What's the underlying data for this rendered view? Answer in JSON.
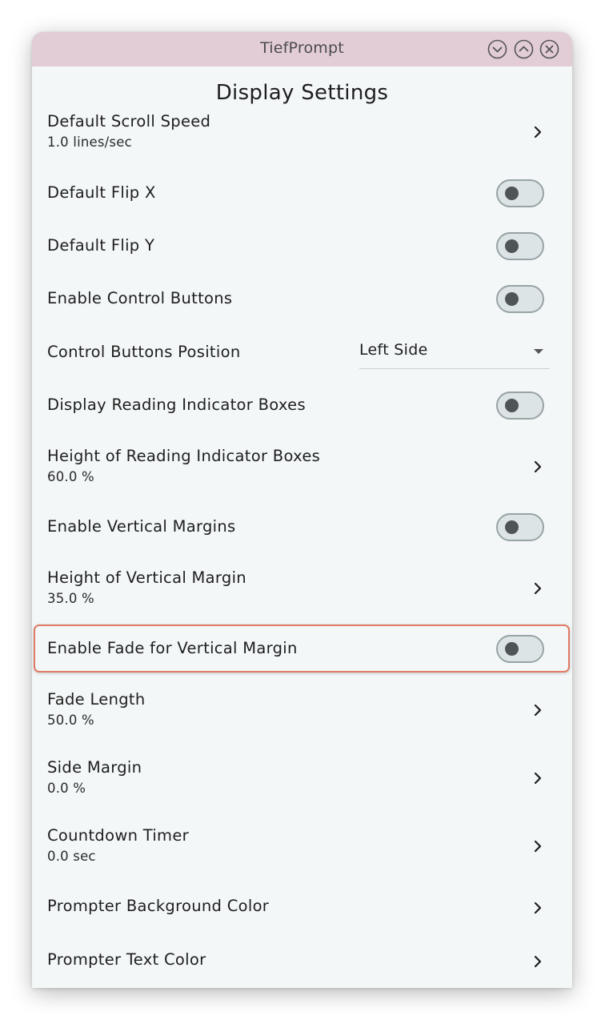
{
  "window": {
    "title": "TiefPrompt",
    "minimize_icon": "chevron-down-circle-icon",
    "maximize_icon": "chevron-up-circle-icon",
    "close_icon": "close-circle-icon",
    "titlebar_color": "#e2ccd6"
  },
  "page": {
    "title": "Display Settings"
  },
  "settings": [
    {
      "label": "Default Scroll Speed",
      "value": "1.0 lines/sec",
      "type": "link"
    },
    {
      "label": "Default Flip X",
      "type": "toggle",
      "on": false
    },
    {
      "label": "Default Flip Y",
      "type": "toggle",
      "on": false
    },
    {
      "label": "Enable Control Buttons",
      "type": "toggle",
      "on": false
    },
    {
      "label": "Control Buttons Position",
      "type": "dropdown",
      "selected": "Left Side"
    },
    {
      "label": "Display Reading Indicator Boxes",
      "type": "toggle",
      "on": false
    },
    {
      "label": "Height of Reading Indicator Boxes",
      "value": "60.0 %",
      "type": "link"
    },
    {
      "label": "Enable Vertical Margins",
      "type": "toggle",
      "on": false
    },
    {
      "label": "Height of Vertical Margin",
      "value": "35.0 %",
      "type": "link"
    },
    {
      "label": "Enable Fade for Vertical Margin",
      "type": "toggle",
      "on": false,
      "highlighted": true
    },
    {
      "label": "Fade Length",
      "value": "50.0 %",
      "type": "link"
    },
    {
      "label": "Side Margin",
      "value": "0.0 %",
      "type": "link"
    },
    {
      "label": "Countdown Timer",
      "value": "0.0 sec",
      "type": "link"
    },
    {
      "label": "Prompter Background Color",
      "type": "link"
    },
    {
      "label": "Prompter Text Color",
      "type": "link"
    }
  ],
  "colors": {
    "background": "#f3f7f8",
    "highlight_border": "#e07a64",
    "toggle_knob": "#4f5557"
  }
}
